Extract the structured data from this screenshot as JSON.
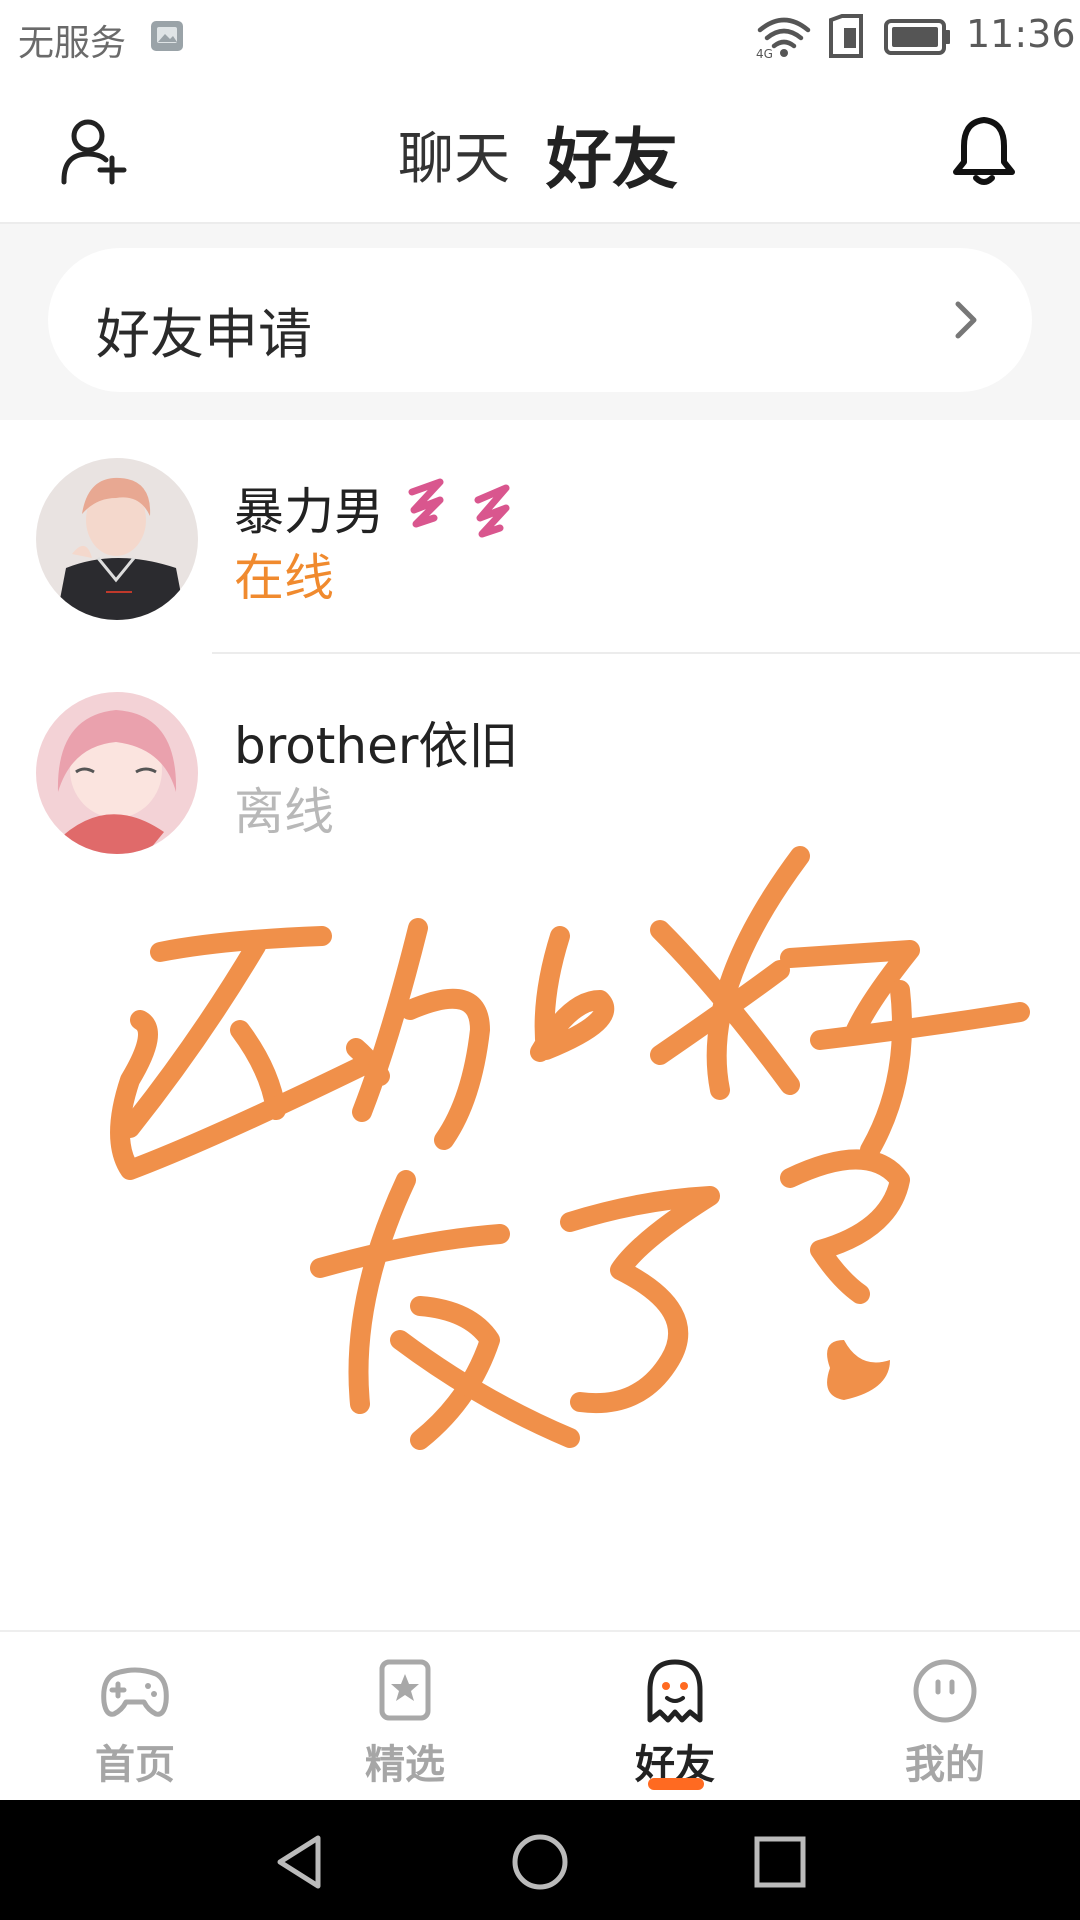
{
  "status_bar": {
    "carrier": "无服务",
    "time": "11:36"
  },
  "header": {
    "tabs": [
      {
        "label": "聊天",
        "active": false
      },
      {
        "label": "好友",
        "active": true
      }
    ]
  },
  "friend_request": {
    "label": "好友申请"
  },
  "friends": [
    {
      "name": "暴力男",
      "status": "在线",
      "online": true
    },
    {
      "name": "brother依旧",
      "status": "离线",
      "online": false
    }
  ],
  "bottom_nav": [
    {
      "label": "首页",
      "icon": "gamepad-icon",
      "active": false
    },
    {
      "label": "精选",
      "icon": "star-bookmark-icon",
      "active": false
    },
    {
      "label": "好友",
      "icon": "ghost-icon",
      "active": true
    },
    {
      "label": "我的",
      "icon": "smiley-icon",
      "active": false
    }
  ],
  "colors": {
    "accent": "#ff5a1f",
    "online": "#f08a2e",
    "offline": "#b8b8b8",
    "doodle": "#f0904a"
  }
}
